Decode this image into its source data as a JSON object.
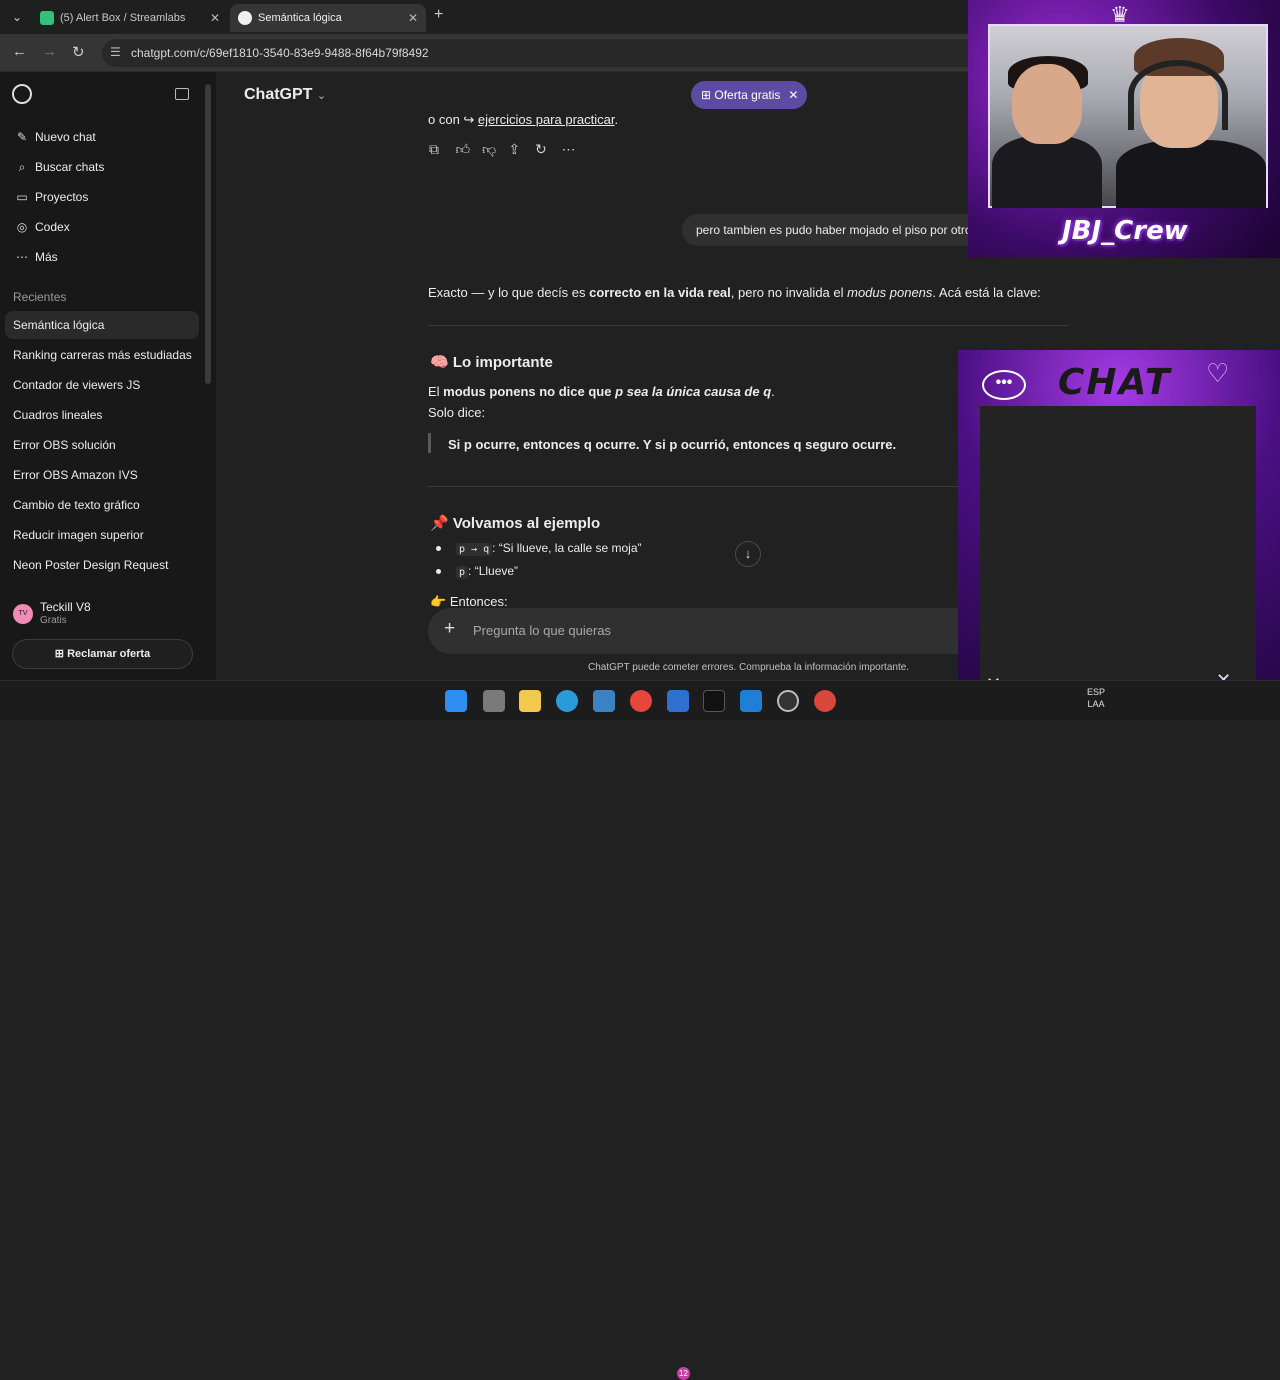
{
  "browser": {
    "tabs": [
      {
        "title": "(5) Alert Box / Streamlabs",
        "active": false
      },
      {
        "title": "Semántica lógica",
        "active": true
      }
    ],
    "url": "chatgpt.com/c/69ef1810-3540-83e9-9488-8f64b79f8492"
  },
  "sidebar": {
    "nav": [
      {
        "label": "Nuevo chat",
        "icon": "compose-icon"
      },
      {
        "label": "Buscar chats",
        "icon": "search-icon"
      },
      {
        "label": "Proyectos",
        "icon": "folder-icon"
      },
      {
        "label": "Codex",
        "icon": "codex-icon"
      },
      {
        "label": "Más",
        "icon": "more-icon"
      }
    ],
    "recents_heading": "Recientes",
    "recents": [
      "Semántica lógica",
      "Ranking carreras más estudiadas",
      "Contador de viewers JS",
      "Cuadros lineales",
      "Error OBS solución",
      "Error OBS Amazon IVS",
      "Cambio de texto gráfico",
      "Reducir imagen superior",
      "Neon Poster Design Request"
    ],
    "user": {
      "initials": "TV",
      "name": "Teckill V8",
      "plan": "Gratis"
    },
    "claim_offer": "Reclamar oferta"
  },
  "header": {
    "title": "ChatGPT",
    "offer": "Oferta gratis"
  },
  "conversation": {
    "prev_tail_prefix": "o con ↪ ",
    "prev_tail_link": "ejercicios para practicar",
    "prev_tail_suffix": ".",
    "user_message": "pero tambien es pudo haber mojado el piso por otro motivo",
    "intro_a": "Exacto — y lo que decís es ",
    "intro_b": "correcto en la vida real",
    "intro_c": ", pero no invalida el ",
    "intro_d": "modus ponens",
    "intro_e": ". Acá está la clave:",
    "section1_emoji": "🧠",
    "section1_title": "Lo importante",
    "s1_line1_a": "El ",
    "s1_line1_b": "modus ponens no dice que ",
    "s1_line1_c": "p sea la única causa de q",
    "s1_line1_d": ".",
    "s1_line2": "Solo dice:",
    "s1_quote": "Si p ocurre, entonces q ocurre. Y si p ocurrió, entonces q seguro ocurre.",
    "section2_emoji": "📌",
    "section2_title": "Volvamos al ejemplo",
    "bullet1_code": "p → q",
    "bullet1_text": ": “Si llueve, la calle se moja”",
    "bullet2_code": "p",
    "bullet2_text": ": “Llueve”",
    "then_emoji": "👉",
    "then_text": "Entonces:"
  },
  "composer": {
    "placeholder": "Pregunta lo que quieras"
  },
  "disclaimer": "ChatGPT puede cometer errores. Comprueba la información importante.",
  "overlays": {
    "crew_label": "JBJ_Crew",
    "chat_label": "CHAT"
  },
  "taskbar": {
    "lang_top": "ESP",
    "lang_bottom": "LAA",
    "teams_badge": "12"
  },
  "colors": {
    "offer_bg": "#5b4ba3",
    "overlay_purple": "#9a2bd8"
  }
}
